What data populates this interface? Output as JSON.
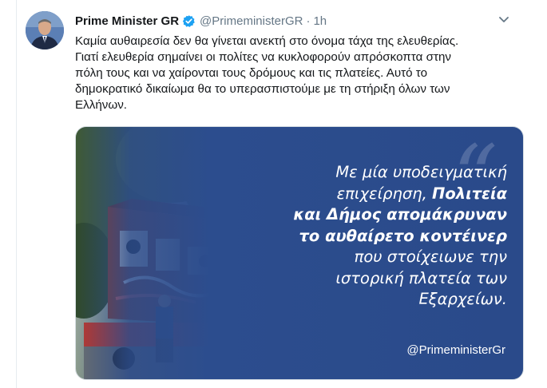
{
  "tweet": {
    "author_name": "Prime Minister GR",
    "handle": "@PrimeministerGR",
    "separator": "·",
    "time": "1h",
    "text_lines": [
      "Καμία αυθαιρεσία δεν θα γίνεται ανεκτή στο όνομα τάχα της ελευθερίας.",
      "Γιατί ελευθερία σημαίνει οι πολίτες να κυκλοφορούν απρόσκοπτα στην",
      "πόλη τους και να χαίρονται τους δρόμους και τις πλατείες. Αυτό το",
      "δημοκρατικό δικαίωμα θα το υπερασπιστούμε με τη στήριξη όλων των",
      "Ελλήνων."
    ]
  },
  "media": {
    "quote_lines": [
      {
        "text": "Με μία υποδειγματική",
        "bold": false
      },
      {
        "text": "επιχείρηση, Πολιτεία",
        "bold": "partial",
        "plain": "επιχείρηση, ",
        "strong": "Πολιτεία"
      },
      {
        "text": "και Δήμος απομάκρυναν",
        "bold": true
      },
      {
        "text": "το αυθαίρετο κοντέινερ",
        "bold": true
      },
      {
        "text": "που στοίχειωνε την",
        "bold": false
      },
      {
        "text": "ιστορική πλατεία των",
        "bold": false
      },
      {
        "text": "Εξαρχείων.",
        "bold": false
      }
    ],
    "line1": "Με μία υποδειγματική",
    "line2_plain": "επιχείρηση, ",
    "line2_bold": "Πολιτεία",
    "line3": "και Δήμος απομάκρυναν",
    "line4": "το αυθαίρετο κοντέινερ",
    "line5": "που στοίχειωνε την",
    "line6": "ιστορική πλατεία των",
    "line7": "Εξαρχείων.",
    "watermark": "@PrimeministerGr",
    "quote_mark": "“",
    "overlay_color": "#2b4c8c"
  },
  "icons": {
    "verified": "verified-badge-icon",
    "caret": "chevron-down-icon"
  },
  "colors": {
    "name": "#14171a",
    "muted": "#657786",
    "verified": "#1da1f2"
  }
}
